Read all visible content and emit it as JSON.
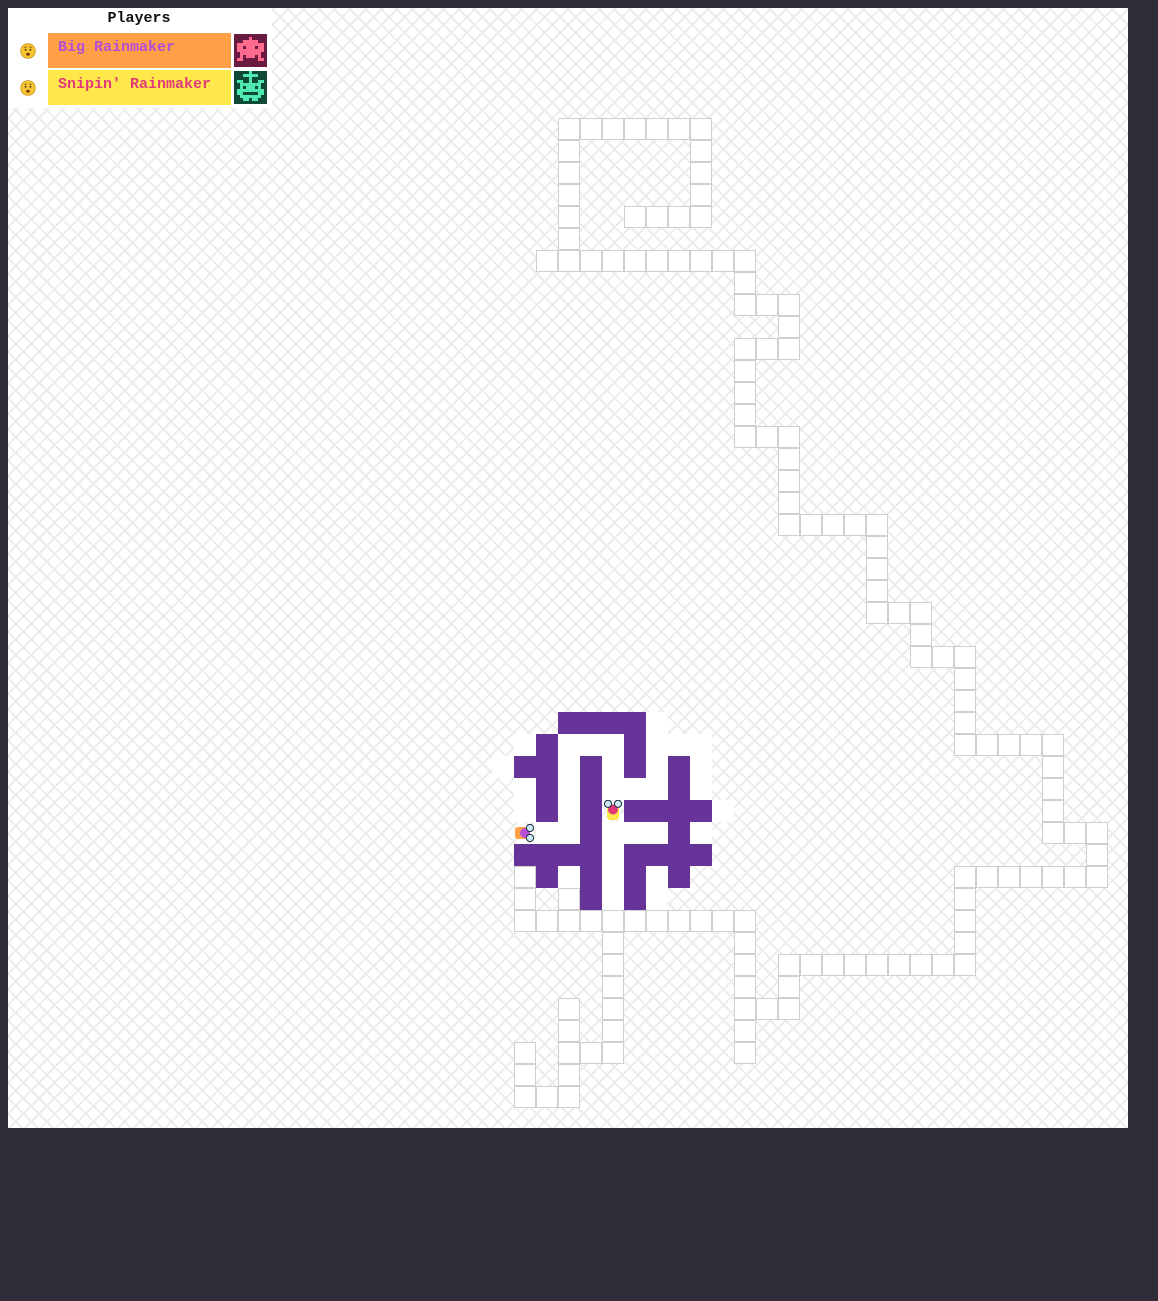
{
  "players_panel": {
    "title": "Players",
    "players": [
      {
        "name": "Big Rainmaker",
        "status_icon": "worried-face-icon",
        "name_color": "#b44fd8",
        "box_color": "#ffa047",
        "avatar_icon": "pink-robot-avatar-icon",
        "avatar_bg": "#6a1c40",
        "avatar_fg": "#ff6a8e"
      },
      {
        "name": "Snipin' Rainmaker",
        "status_icon": "worried-face-icon",
        "name_color": "#e2397d",
        "box_color": "#ffe84a",
        "avatar_icon": "green-robot-avatar-icon",
        "avatar_bg": "#0e4a36",
        "avatar_fg": "#4fe8b0"
      }
    ]
  },
  "board": {
    "grid_size": 50,
    "wall_color": "#663399",
    "snakes": [
      {
        "name": "Big Rainmaker",
        "head_color": "#b44fd8",
        "body_color": "#ffa047",
        "head_direction": "right",
        "cell": [
          23,
          37
        ]
      },
      {
        "name": "Snipin' Rainmaker",
        "head_color": "#e2397d",
        "body_color": "#ffe84a",
        "head_direction": "up",
        "cell": [
          27,
          36
        ]
      }
    ],
    "walls": [
      [
        25,
        32
      ],
      [
        26,
        32
      ],
      [
        27,
        32
      ],
      [
        28,
        32
      ],
      [
        24,
        33
      ],
      [
        28,
        33
      ],
      [
        23,
        34
      ],
      [
        24,
        34
      ],
      [
        26,
        34
      ],
      [
        28,
        34
      ],
      [
        30,
        34
      ],
      [
        24,
        35
      ],
      [
        26,
        35
      ],
      [
        30,
        35
      ],
      [
        24,
        36
      ],
      [
        26,
        36
      ],
      [
        28,
        36
      ],
      [
        29,
        36
      ],
      [
        30,
        36
      ],
      [
        31,
        36
      ],
      [
        26,
        37
      ],
      [
        30,
        37
      ],
      [
        23,
        38
      ],
      [
        24,
        38
      ],
      [
        25,
        38
      ],
      [
        26,
        38
      ],
      [
        28,
        38
      ],
      [
        29,
        38
      ],
      [
        30,
        38
      ],
      [
        31,
        38
      ],
      [
        24,
        39
      ],
      [
        26,
        39
      ],
      [
        28,
        39
      ],
      [
        30,
        39
      ],
      [
        26,
        40
      ],
      [
        28,
        40
      ]
    ],
    "clear_cells": [
      [
        29,
        32
      ],
      [
        23,
        33
      ],
      [
        25,
        33
      ],
      [
        26,
        33
      ],
      [
        27,
        33
      ],
      [
        29,
        33
      ],
      [
        30,
        33
      ],
      [
        31,
        33
      ],
      [
        22,
        34
      ],
      [
        25,
        34
      ],
      [
        27,
        34
      ],
      [
        29,
        34
      ],
      [
        31,
        34
      ],
      [
        23,
        35
      ],
      [
        25,
        35
      ],
      [
        27,
        35
      ],
      [
        28,
        35
      ],
      [
        29,
        35
      ],
      [
        31,
        35
      ],
      [
        23,
        36
      ],
      [
        25,
        36
      ],
      [
        32,
        36
      ],
      [
        24,
        37
      ],
      [
        25,
        37
      ],
      [
        27,
        37
      ],
      [
        28,
        37
      ],
      [
        29,
        37
      ],
      [
        31,
        37
      ],
      [
        27,
        38
      ],
      [
        25,
        39
      ],
      [
        27,
        39
      ],
      [
        29,
        39
      ],
      [
        27,
        40
      ],
      [
        29,
        40
      ]
    ],
    "floor_path": [
      [
        25,
        5
      ],
      [
        26,
        5
      ],
      [
        27,
        5
      ],
      [
        28,
        5
      ],
      [
        29,
        5
      ],
      [
        30,
        5
      ],
      [
        31,
        5
      ],
      [
        25,
        6
      ],
      [
        31,
        6
      ],
      [
        25,
        7
      ],
      [
        31,
        7
      ],
      [
        25,
        8
      ],
      [
        31,
        8
      ],
      [
        25,
        9
      ],
      [
        28,
        9
      ],
      [
        29,
        9
      ],
      [
        30,
        9
      ],
      [
        31,
        9
      ],
      [
        25,
        10
      ],
      [
        24,
        11
      ],
      [
        25,
        11
      ],
      [
        26,
        11
      ],
      [
        27,
        11
      ],
      [
        28,
        11
      ],
      [
        29,
        11
      ],
      [
        30,
        11
      ],
      [
        31,
        11
      ],
      [
        32,
        11
      ],
      [
        33,
        11
      ],
      [
        33,
        12
      ],
      [
        33,
        13
      ],
      [
        34,
        13
      ],
      [
        35,
        13
      ],
      [
        35,
        14
      ],
      [
        33,
        15
      ],
      [
        34,
        15
      ],
      [
        35,
        15
      ],
      [
        33,
        16
      ],
      [
        33,
        17
      ],
      [
        33,
        18
      ],
      [
        33,
        19
      ],
      [
        34,
        19
      ],
      [
        35,
        19
      ],
      [
        35,
        20
      ],
      [
        35,
        21
      ],
      [
        35,
        22
      ],
      [
        35,
        23
      ],
      [
        36,
        23
      ],
      [
        37,
        23
      ],
      [
        38,
        23
      ],
      [
        39,
        23
      ],
      [
        39,
        24
      ],
      [
        39,
        25
      ],
      [
        39,
        26
      ],
      [
        39,
        27
      ],
      [
        40,
        27
      ],
      [
        41,
        27
      ],
      [
        41,
        28
      ],
      [
        41,
        29
      ],
      [
        42,
        29
      ],
      [
        43,
        29
      ],
      [
        43,
        30
      ],
      [
        43,
        31
      ],
      [
        43,
        32
      ],
      [
        43,
        33
      ],
      [
        44,
        33
      ],
      [
        45,
        33
      ],
      [
        46,
        33
      ],
      [
        47,
        33
      ],
      [
        47,
        34
      ],
      [
        47,
        35
      ],
      [
        47,
        36
      ],
      [
        47,
        37
      ],
      [
        48,
        37
      ],
      [
        49,
        37
      ],
      [
        49,
        38
      ],
      [
        43,
        39
      ],
      [
        44,
        39
      ],
      [
        45,
        39
      ],
      [
        46,
        39
      ],
      [
        47,
        39
      ],
      [
        48,
        39
      ],
      [
        49,
        39
      ],
      [
        43,
        40
      ],
      [
        43,
        41
      ],
      [
        43,
        42
      ],
      [
        35,
        43
      ],
      [
        36,
        43
      ],
      [
        37,
        43
      ],
      [
        38,
        43
      ],
      [
        39,
        43
      ],
      [
        40,
        43
      ],
      [
        41,
        43
      ],
      [
        42,
        43
      ],
      [
        43,
        43
      ],
      [
        35,
        44
      ],
      [
        35,
        45
      ],
      [
        23,
        39
      ],
      [
        23,
        40
      ],
      [
        25,
        40
      ],
      [
        23,
        41
      ],
      [
        24,
        41
      ],
      [
        25,
        41
      ],
      [
        26,
        41
      ],
      [
        27,
        41
      ],
      [
        28,
        41
      ],
      [
        29,
        41
      ],
      [
        30,
        41
      ],
      [
        31,
        41
      ],
      [
        32,
        41
      ],
      [
        33,
        41
      ],
      [
        27,
        42
      ],
      [
        33,
        42
      ],
      [
        27,
        43
      ],
      [
        33,
        43
      ],
      [
        27,
        44
      ],
      [
        33,
        44
      ],
      [
        25,
        45
      ],
      [
        27,
        45
      ],
      [
        33,
        45
      ],
      [
        34,
        45
      ],
      [
        25,
        46
      ],
      [
        27,
        46
      ],
      [
        33,
        46
      ],
      [
        23,
        47
      ],
      [
        25,
        47
      ],
      [
        26,
        47
      ],
      [
        27,
        47
      ],
      [
        33,
        47
      ],
      [
        23,
        48
      ],
      [
        25,
        48
      ],
      [
        23,
        49
      ],
      [
        24,
        49
      ],
      [
        25,
        49
      ]
    ]
  }
}
